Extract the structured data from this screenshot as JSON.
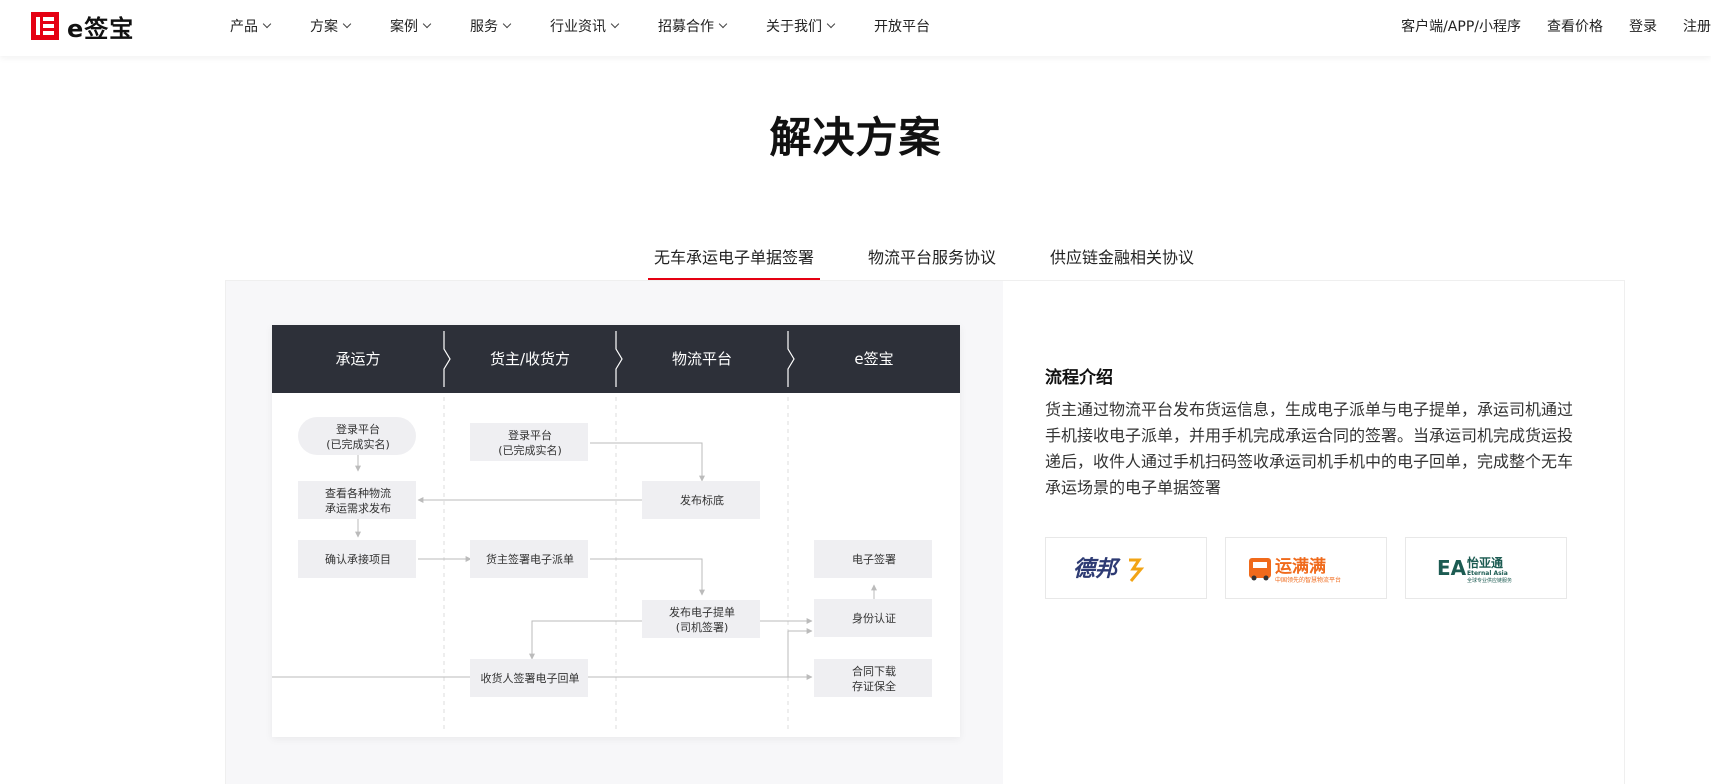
{
  "header": {
    "logo_text": "e签宝",
    "nav": [
      {
        "label": "产品",
        "has_dropdown": true
      },
      {
        "label": "方案",
        "has_dropdown": true
      },
      {
        "label": "案例",
        "has_dropdown": true
      },
      {
        "label": "服务",
        "has_dropdown": true
      },
      {
        "label": "行业资讯",
        "has_dropdown": true
      },
      {
        "label": "招募合作",
        "has_dropdown": true
      },
      {
        "label": "关于我们",
        "has_dropdown": true
      },
      {
        "label": "开放平台",
        "has_dropdown": false
      }
    ],
    "right_links": [
      "客户端/APP/小程序",
      "查看价格",
      "登录",
      "注册"
    ],
    "brand_color": "#e50012"
  },
  "page": {
    "title": "解决方案",
    "tabs": [
      {
        "label": "无车承运电子单据签署",
        "active": true
      },
      {
        "label": "物流平台服务协议",
        "active": false
      },
      {
        "label": "供应链金融相关协议",
        "active": false
      }
    ]
  },
  "diagram": {
    "columns": [
      "承运方",
      "货主/收货方",
      "物流平台",
      "e签宝"
    ],
    "boxes": {
      "carrier_login_1": "登录平台",
      "carrier_login_2": "(已完成实名)",
      "carrier_view_1": "查看各种物流",
      "carrier_view_2": "承运需求发布",
      "carrier_confirm": "确认承接项目",
      "owner_login_1": "登录平台",
      "owner_login_2": "(已完成实名)",
      "owner_sign": "货主签署电子派单",
      "receiver_sign": "收货人签署电子回单",
      "platform_publish": "发布标底",
      "platform_bill_1": "发布电子提单",
      "platform_bill_2": "(司机签署)",
      "esign_sign": "电子签署",
      "esign_auth": "身份认证",
      "esign_download_1": "合同下载",
      "esign_download_2": "存证保全"
    }
  },
  "intro": {
    "title": "流程介绍",
    "text": "货主通过物流平台发布货运信息，生成电子派单与电子提单，承运司机通过手机接收电子派单，并用手机完成承运合同的签署。当承运司机完成货运投递后，收件人通过手机扫码签收承运司机手机中的电子回单，完成整个无车承运场景的电子单据签署"
  },
  "partners": {
    "debang": "德邦",
    "yunmanman": "运满满",
    "yunmanman_sub": "中国领先的智慧物流平台",
    "yiyatong": "怡亚通",
    "yiyatong_en": "Eternal Asia",
    "yiyatong_sub": "全球专业供应链服务"
  }
}
